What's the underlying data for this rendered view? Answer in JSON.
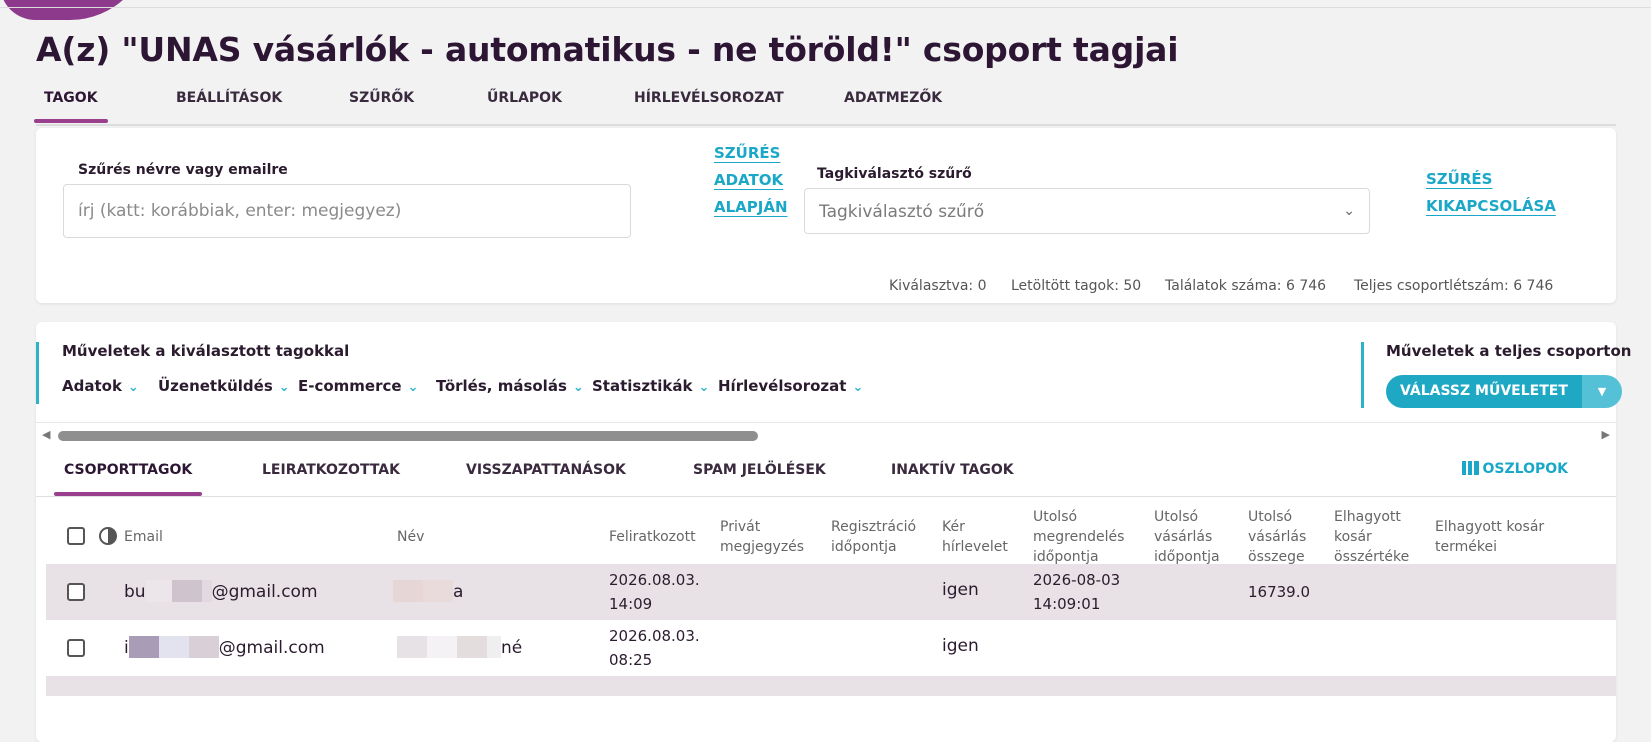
{
  "page_title": "A(z) \"UNAS vásárlók - automatikus - ne töröld!\" csoport tagjai",
  "main_tabs": [
    {
      "label": "TAGOK",
      "active": true
    },
    {
      "label": "BEÁLLÍTÁSOK"
    },
    {
      "label": "SZŰRŐK"
    },
    {
      "label": "ŰRLAPOK"
    },
    {
      "label": "HÍRLEVÉLSOROZAT"
    },
    {
      "label": "ADATMEZŐK"
    }
  ],
  "filter": {
    "search_label": "Szűrés névre vagy emailre",
    "search_placeholder": "írj (katt: korábbiak, enter: megjegyez)",
    "data_filter_link": [
      "SZŰRÉS",
      "ADATOK",
      "ALAPJÁN"
    ],
    "member_filter_label": "Tagkiválasztó szűrő",
    "member_filter_value": "Tagkiválasztó szűrő",
    "disable_filter_link": [
      "SZŰRÉS",
      "KIKAPCSOLÁSA"
    ]
  },
  "stats": {
    "selected": "Kiválasztva: 0",
    "loaded": "Letöltött tagok: 50",
    "results": "Találatok száma: 6 746",
    "total": "Teljes csoportlétszám: 6 746"
  },
  "operations": {
    "selected_title": "Műveletek a kiválasztott tagokkal",
    "selected_items": [
      "Adatok",
      "Üzenetküldés",
      "E-commerce",
      "Törlés, másolás",
      "Statisztikák",
      "Hírlevélsorozat"
    ],
    "group_title": "Műveletek a teljes csoporton",
    "group_button": "VÁLASSZ MŰVELETET"
  },
  "sub_tabs": [
    {
      "label": "CSOPORTTAGOK",
      "active": true
    },
    {
      "label": "LEIRATKOZOTTAK"
    },
    {
      "label": "VISSZAPATTANÁSOK"
    },
    {
      "label": "SPAM JELÖLÉSEK"
    },
    {
      "label": "INAKTÍV TAGOK"
    }
  ],
  "columns_button": "OSZLOPOK",
  "table": {
    "headers": [
      "Email",
      "Név",
      "Feliratkozott",
      [
        "Privát",
        "megjegyzés"
      ],
      [
        "Regisztráció",
        "időpontja"
      ],
      [
        "Kér",
        "hírlevelet"
      ],
      [
        "Utolsó",
        "megrendelés",
        "időpontja"
      ],
      [
        "Utolsó",
        "vásárlás",
        "időpontja"
      ],
      [
        "Utolsó",
        "vásárlás",
        "összege"
      ],
      [
        "Elhagyott",
        "kosár",
        "összértéke"
      ],
      [
        "Elhagyott kosár",
        "termékei"
      ]
    ],
    "rows": [
      {
        "email_prefix": "bu",
        "email_suffix": "@gmail.com",
        "name_suffix": "a",
        "subscribed": [
          "2026.08.03.",
          "14:09"
        ],
        "wants_newsletter": "igen",
        "last_order": [
          "2026-08-03",
          "14:09:01"
        ],
        "last_purchase_amount": "16739.0"
      },
      {
        "email_prefix": "i",
        "email_suffix": "@gmail.com",
        "name_suffix": "né",
        "subscribed": [
          "2026.08.03.",
          "08:25"
        ],
        "wants_newsletter": "igen"
      }
    ]
  },
  "colors": {
    "accent_purple": "#9a3f8d",
    "accent_teal": "#1ba8c8",
    "title": "#2d1634",
    "selected_row": "#e8e2e6"
  },
  "horizontal_scroll_position": 0
}
